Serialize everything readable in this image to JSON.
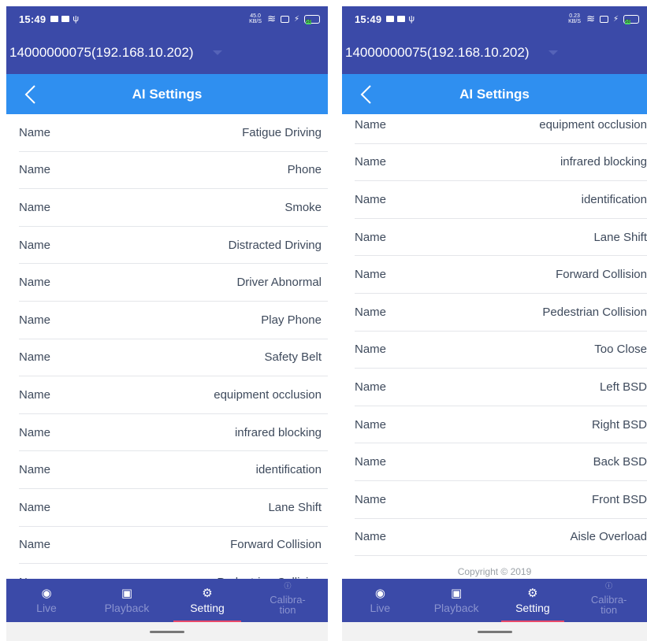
{
  "status": {
    "time": "15:49",
    "netspeed_left": "45.0 KB/S",
    "netspeed_right": "0.23 KB/S",
    "battery": "58"
  },
  "device": {
    "label": "14000000075(192.168.10.202)"
  },
  "header": {
    "title": "AI Settings"
  },
  "left_list": [
    {
      "name": "Name",
      "value": "Fatigue Driving"
    },
    {
      "name": "Name",
      "value": "Phone"
    },
    {
      "name": "Name",
      "value": "Smoke"
    },
    {
      "name": "Name",
      "value": "Distracted Driving"
    },
    {
      "name": "Name",
      "value": "Driver Abnormal"
    },
    {
      "name": "Name",
      "value": "Play Phone"
    },
    {
      "name": "Name",
      "value": "Safety Belt"
    },
    {
      "name": "Name",
      "value": "equipment occlusion"
    },
    {
      "name": "Name",
      "value": "infrared blocking"
    },
    {
      "name": "Name",
      "value": "identification"
    },
    {
      "name": "Name",
      "value": "Lane Shift"
    },
    {
      "name": "Name",
      "value": "Forward Collision"
    },
    {
      "name": "Name",
      "value": "Pedestrian Collision"
    }
  ],
  "right_list": [
    {
      "name": "Name",
      "value": "equipment occlusion"
    },
    {
      "name": "Name",
      "value": "infrared blocking"
    },
    {
      "name": "Name",
      "value": "identification"
    },
    {
      "name": "Name",
      "value": "Lane Shift"
    },
    {
      "name": "Name",
      "value": "Forward Collision"
    },
    {
      "name": "Name",
      "value": "Pedestrian Collision"
    },
    {
      "name": "Name",
      "value": "Too Close"
    },
    {
      "name": "Name",
      "value": "Left BSD"
    },
    {
      "name": "Name",
      "value": "Right BSD"
    },
    {
      "name": "Name",
      "value": "Back BSD"
    },
    {
      "name": "Name",
      "value": "Front BSD"
    },
    {
      "name": "Name",
      "value": "Aisle Overload"
    }
  ],
  "footer": {
    "copyright": "Copyright © 2019"
  },
  "tabs": {
    "live": "Live",
    "playback": "Playback",
    "setting": "Setting",
    "calibration_line1": "Calibra-",
    "calibration_line2": "tion"
  },
  "icons": {
    "live": "camera-icon",
    "playback": "image-icon",
    "setting": "gear-icon",
    "calibration": "info-icon",
    "back": "chevron-left-icon"
  },
  "colors": {
    "header_bg": "#3b4aa8",
    "title_bar": "#2f8ff0",
    "active_underline": "#e84a6a"
  }
}
